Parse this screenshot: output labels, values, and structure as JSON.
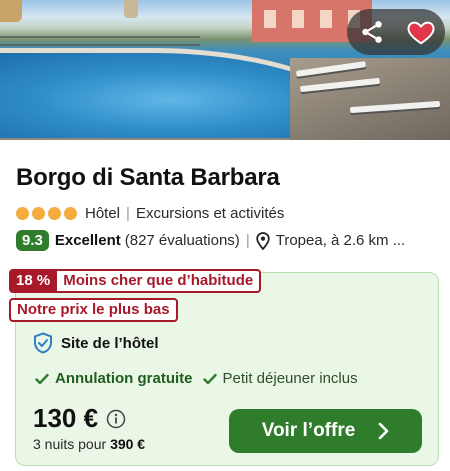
{
  "hotel": {
    "name": "Borgo di Santa Barbara",
    "stars_count": 4,
    "type": "Hôtel",
    "category": "Excursions et activités",
    "score": "9.3",
    "rating_word": "Excellent",
    "reviews": "(827 évaluations)",
    "location": "Tropea, à 2.6 km ..."
  },
  "actions": {
    "share_icon": "share-icon",
    "favorite_icon": "heart-icon",
    "favorite_color": "#e2374a"
  },
  "deal": {
    "discount": "18 %",
    "discount_label": "Moins cher que d’habitude",
    "lowest_label": "Notre prix le plus bas",
    "provider": "Site de l’hôtel",
    "perks": [
      "Annulation gratuite",
      "Petit déjeuner inclus"
    ],
    "price": "130 €",
    "nights_prefix": "3 nuits pour",
    "nights_total": "390 €",
    "cta": "Voir l’offre"
  },
  "colors": {
    "brand_green": "#2f7d2c",
    "deal_red": "#a7192a",
    "card_bg": "#eaf6e6",
    "star_orange": "#f6ab3f"
  }
}
